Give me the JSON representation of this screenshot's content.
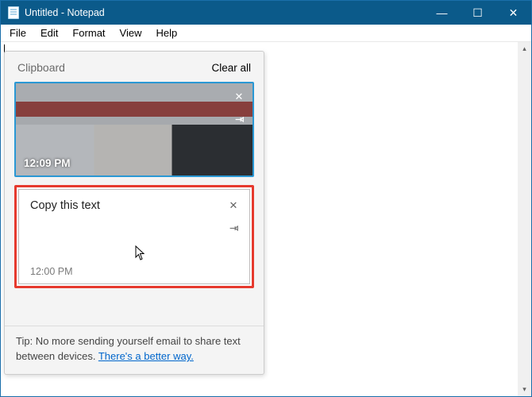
{
  "window": {
    "title": "Untitled - Notepad"
  },
  "menu": {
    "file": "File",
    "edit": "Edit",
    "format": "Format",
    "view": "View",
    "help": "Help"
  },
  "clipboard": {
    "title": "Clipboard",
    "clear_all": "Clear all",
    "items": [
      {
        "type": "image",
        "timestamp": "12:09 PM"
      },
      {
        "type": "text",
        "content": "Copy this text",
        "timestamp": "12:00 PM"
      }
    ],
    "tip_prefix": "Tip: No more sending yourself email to share text between devices.  ",
    "tip_link": "There's a better way."
  },
  "icons": {
    "minimize": "—",
    "maximize": "☐",
    "close": "✕",
    "item_close": "✕",
    "item_pin": "⊷",
    "scroll_up": "▴",
    "scroll_down": "▾"
  }
}
